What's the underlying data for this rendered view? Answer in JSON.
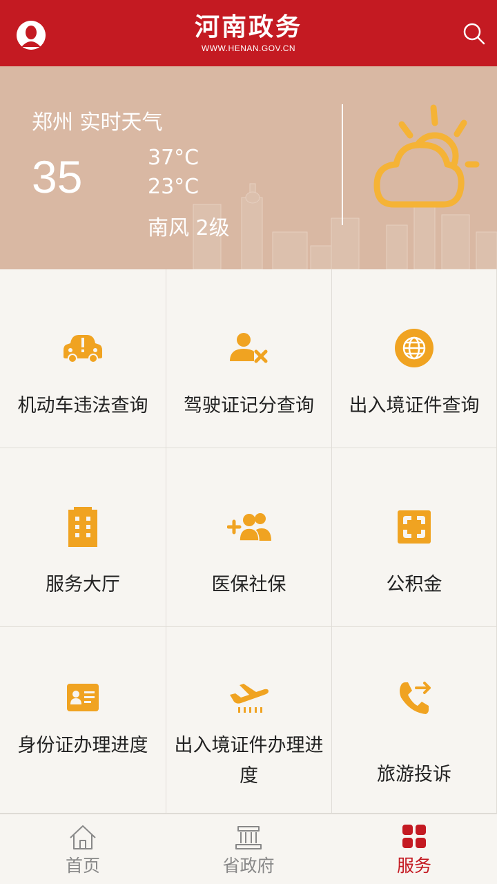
{
  "header": {
    "title": "河南政务",
    "url": "WWW.HENAN.GOV.CN",
    "brand_color": "#c41a22"
  },
  "weather": {
    "city_label": "郑州 实时天气",
    "current_temp": "35",
    "high_temp": "37°C",
    "low_temp": "23°C",
    "wind": "南风 2级",
    "icon": "partly-sunny-icon"
  },
  "services": [
    {
      "label": "机动车违法查询",
      "icon": "car-warning-icon"
    },
    {
      "label": "驾驶证记分查询",
      "icon": "user-x-icon"
    },
    {
      "label": "出入境证件查询",
      "icon": "globe-icon"
    },
    {
      "label": "服务大厅",
      "icon": "building-icon"
    },
    {
      "label": "医保社保",
      "icon": "add-users-icon"
    },
    {
      "label": "公积金",
      "icon": "fund-icon"
    },
    {
      "label": "身份证办理进度",
      "icon": "id-card-icon"
    },
    {
      "label": "出入境证件办理进度",
      "icon": "airplane-icon"
    },
    {
      "label": "旅游投诉",
      "icon": "phone-forward-icon"
    }
  ],
  "nav": [
    {
      "label": "首页",
      "icon": "home-icon",
      "active": false
    },
    {
      "label": "省政府",
      "icon": "government-icon",
      "active": false
    },
    {
      "label": "服务",
      "icon": "grid-icon",
      "active": true
    }
  ],
  "colors": {
    "accent": "#f0a321",
    "weather_bg": "#d9b8a3",
    "active_nav": "#c41a22"
  }
}
